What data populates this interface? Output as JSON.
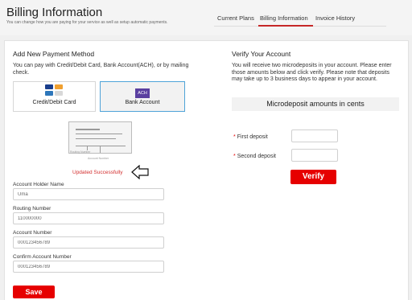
{
  "header": {
    "title": "Billing Information",
    "subtitle": "You can change how you are paying for your service as well as setup automatic payments.",
    "tabs": [
      {
        "label": "Current Plans"
      },
      {
        "label": "Billing Information"
      },
      {
        "label": "Invoice History"
      }
    ],
    "active_tab": "Billing Information"
  },
  "payment": {
    "heading": "Add New Payment Method",
    "description": "You can pay with Credit/Debit Card, Bank Account(ACH), or by mailing check.",
    "options": [
      {
        "label": "Credit/Debit Card",
        "selected": false
      },
      {
        "label": "Bank Account",
        "selected": true
      }
    ],
    "ach_badge": "ACH",
    "check_small_labels": [
      "Routing Number",
      "Account Number"
    ],
    "status": "Updated Successfully",
    "fields": [
      {
        "label": "Account Holder Name",
        "value": "Uma"
      },
      {
        "label": "Routing Number",
        "value": "110000000"
      },
      {
        "label": "Account Number",
        "value": "000123456789"
      },
      {
        "label": "Confirm Account Number",
        "value": "000123456789"
      }
    ],
    "save_label": "Save"
  },
  "verify": {
    "heading": "Verify Your Account",
    "description": "You will receive two microdeposits in your account. Please enter those amounts below and click verify. Please note that deposits may take up to 3 business days to appear in your account.",
    "amounts_title": "Microdeposit amounts in cents",
    "deposits": [
      {
        "label": "First deposit",
        "value": ""
      },
      {
        "label": "Second deposit",
        "value": ""
      }
    ],
    "required_mark": "*",
    "verify_label": "Verify"
  },
  "colors": {
    "accent": "#e60000",
    "selected_border": "#4fa3d8",
    "tab_underline": "#c62828",
    "ach": "#5a3fa0"
  },
  "icons": [
    "credit-cards-icon",
    "ach-icon",
    "check-illustration",
    "left-arrow-icon"
  ]
}
